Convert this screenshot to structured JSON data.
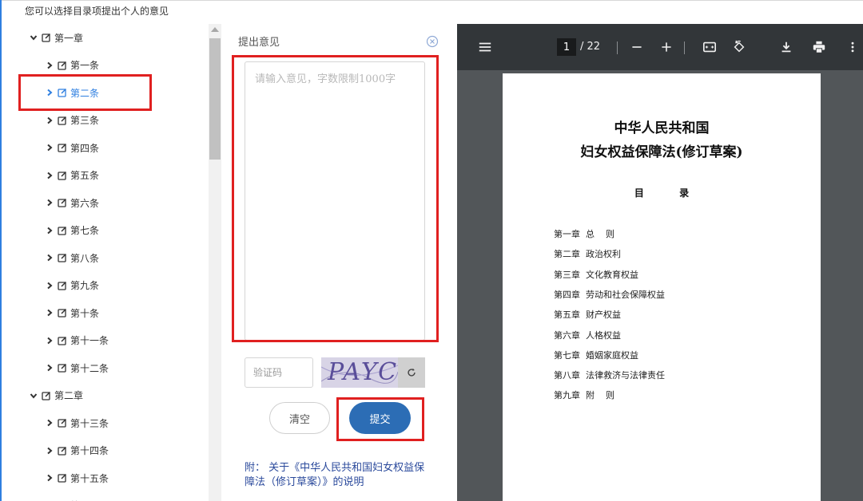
{
  "hint": "您可以选择目录项提出个人的意见",
  "tree": {
    "items": [
      {
        "label": "第一章",
        "level": 0,
        "expanded": true
      },
      {
        "label": "第一条",
        "level": 1
      },
      {
        "label": "第二条",
        "level": 1,
        "active": true
      },
      {
        "label": "第三条",
        "level": 1
      },
      {
        "label": "第四条",
        "level": 1
      },
      {
        "label": "第五条",
        "level": 1
      },
      {
        "label": "第六条",
        "level": 1
      },
      {
        "label": "第七条",
        "level": 1
      },
      {
        "label": "第八条",
        "level": 1
      },
      {
        "label": "第九条",
        "level": 1
      },
      {
        "label": "第十条",
        "level": 1
      },
      {
        "label": "第十一条",
        "level": 1
      },
      {
        "label": "第十二条",
        "level": 1
      },
      {
        "label": "第二章",
        "level": 0,
        "expanded": true
      },
      {
        "label": "第十三条",
        "level": 1
      },
      {
        "label": "第十四条",
        "level": 1
      },
      {
        "label": "第十五条",
        "level": 1
      },
      {
        "label": "第...",
        "level": 1
      }
    ]
  },
  "opinion": {
    "title": "提出意见",
    "placeholder": "请输入意见，字数限制1000字",
    "captcha_placeholder": "验证码",
    "captcha_text": "PAYC",
    "clear_label": "清空",
    "submit_label": "提交",
    "appendix_link": "附： 关于《中华人民共和国妇女权益保障法（修订草案）》的说明"
  },
  "pdf": {
    "current_page": "1",
    "total_pages": "/ 22",
    "title_line1": "中华人民共和国",
    "title_line2": "妇女权益保障法(修订草案)",
    "toc_heading": "目 录",
    "toc": [
      "第一章  总    则",
      "第二章  政治权利",
      "第三章  文化教育权益",
      "第四章  劳动和社会保障权益",
      "第五章  财产权益",
      "第六章  人格权益",
      "第七章  婚姻家庭权益",
      "第八章  法律救济与法律责任",
      "第九章  附    则"
    ]
  },
  "colors": {
    "accent": "#2f7fe0",
    "highlight": "#e02020",
    "submit": "#2c6db5",
    "toolbar": "#323639",
    "viewer_bg": "#525659"
  }
}
